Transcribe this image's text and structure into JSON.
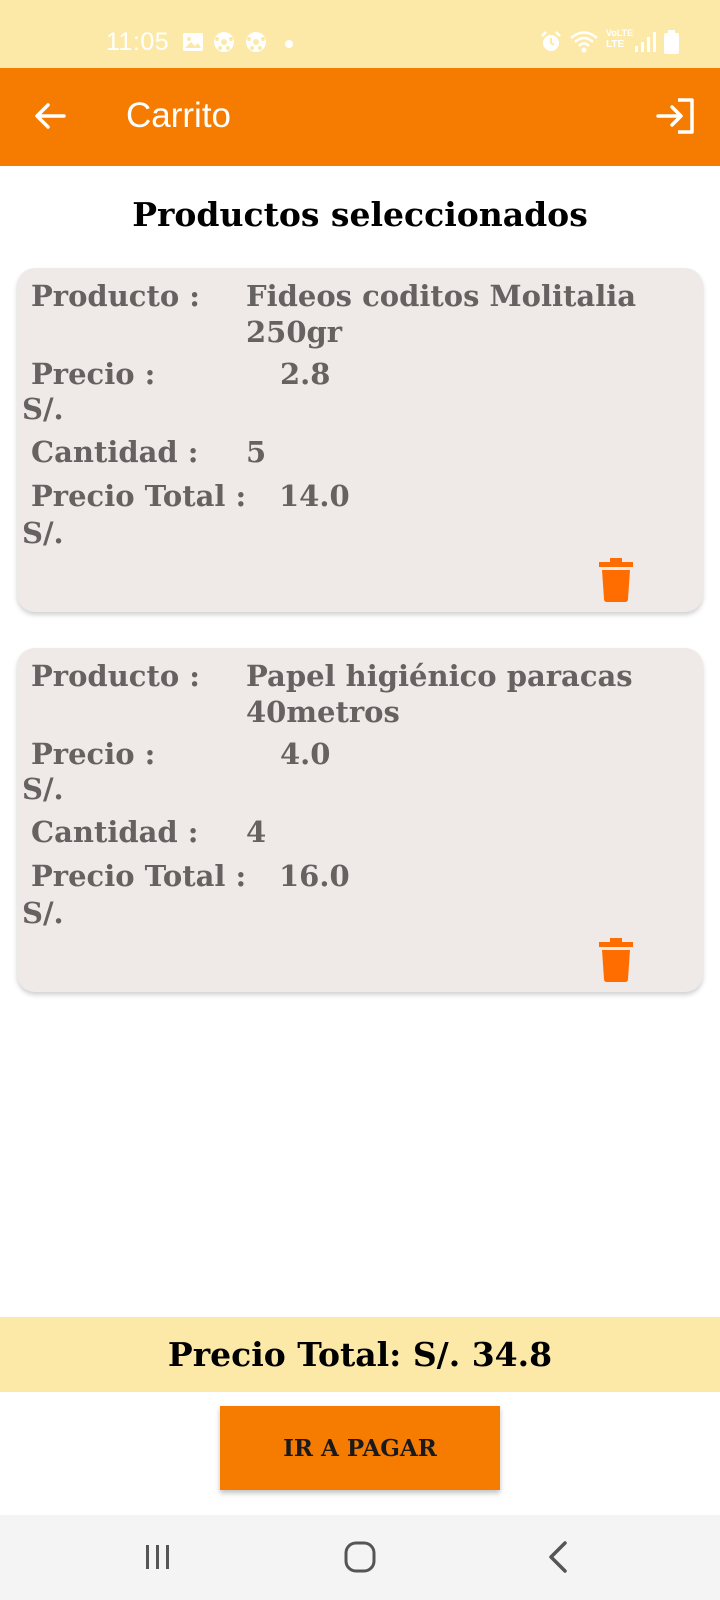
{
  "status_bar": {
    "time": "11:05",
    "volte_line1": "VoLTE",
    "volte_line2": "LTE"
  },
  "app_bar": {
    "title": "Carrito",
    "back_icon": "arrow-left-icon",
    "login_icon": "login-icon",
    "color": "#f57c00"
  },
  "page": {
    "heading": "Productos seleccionados"
  },
  "cards": [
    {
      "producto_label": "Producto :",
      "producto_value": "Fideos coditos Molitalia 250gr",
      "precio_label": "Precio :",
      "precio_value": "2.8",
      "currency": "S/.",
      "cantidad_label": "Cantidad :",
      "cantidad_value": "5",
      "precio_total_label": "Precio Total :",
      "precio_total_value": "14.0",
      "delete_icon": "trash-icon"
    },
    {
      "producto_label": "Producto :",
      "producto_value": "Papel higiénico paracas 40metros",
      "precio_label": "Precio :",
      "precio_value": "4.0",
      "currency": "S/.",
      "cantidad_label": "Cantidad :",
      "cantidad_value": "4",
      "precio_total_label": "Precio Total :",
      "precio_total_value": "16.0",
      "delete_icon": "trash-icon"
    }
  ],
  "footer": {
    "total_text": "Precio Total: S/. 34.8",
    "pay_button": "IR A PAGAR"
  },
  "nav_bar": {
    "recent_icon": "recent-apps-icon",
    "home_icon": "home-icon",
    "back_icon": "back-icon"
  }
}
